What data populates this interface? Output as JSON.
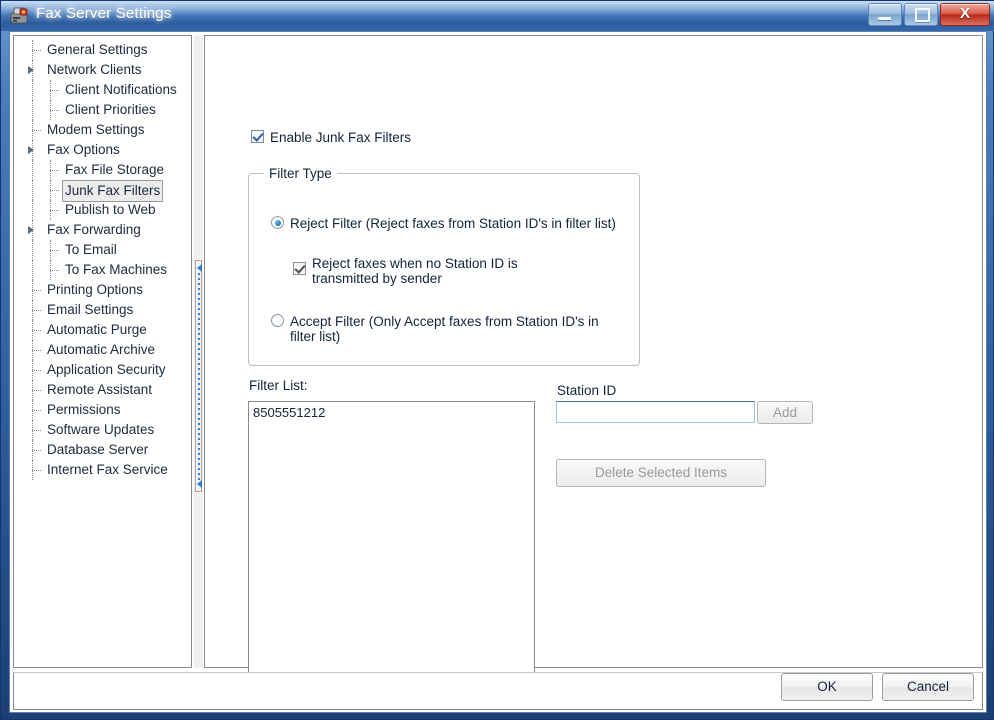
{
  "window": {
    "title": "Fax Server Settings",
    "icon": "fax-machine-icon",
    "controls": {
      "minimize": "Minimize",
      "maximize": "Maximize",
      "close": "Close",
      "close_glyph": "X"
    }
  },
  "sidebar": {
    "items": [
      {
        "label": "General Settings",
        "level": 1,
        "expandable": false,
        "selected": false
      },
      {
        "label": "Network Clients",
        "level": 1,
        "expandable": true,
        "selected": false
      },
      {
        "label": "Client Notifications",
        "level": 2,
        "expandable": false,
        "selected": false
      },
      {
        "label": "Client Priorities",
        "level": 2,
        "expandable": false,
        "selected": false
      },
      {
        "label": "Modem Settings",
        "level": 1,
        "expandable": false,
        "selected": false
      },
      {
        "label": "Fax Options",
        "level": 1,
        "expandable": true,
        "selected": false
      },
      {
        "label": "Fax File Storage",
        "level": 2,
        "expandable": false,
        "selected": false
      },
      {
        "label": "Junk Fax Filters",
        "level": 2,
        "expandable": false,
        "selected": true
      },
      {
        "label": "Publish to Web",
        "level": 2,
        "expandable": false,
        "selected": false
      },
      {
        "label": "Fax Forwarding",
        "level": 1,
        "expandable": true,
        "selected": false
      },
      {
        "label": "To Email",
        "level": 2,
        "expandable": false,
        "selected": false
      },
      {
        "label": "To Fax Machines",
        "level": 2,
        "expandable": false,
        "selected": false
      },
      {
        "label": "Printing Options",
        "level": 1,
        "expandable": false,
        "selected": false
      },
      {
        "label": "Email Settings",
        "level": 1,
        "expandable": false,
        "selected": false
      },
      {
        "label": "Automatic Purge",
        "level": 1,
        "expandable": false,
        "selected": false
      },
      {
        "label": "Automatic Archive",
        "level": 1,
        "expandable": false,
        "selected": false
      },
      {
        "label": "Application Security",
        "level": 1,
        "expandable": false,
        "selected": false
      },
      {
        "label": "Remote Assistant",
        "level": 1,
        "expandable": false,
        "selected": false
      },
      {
        "label": "Permissions",
        "level": 1,
        "expandable": false,
        "selected": false
      },
      {
        "label": "Software Updates",
        "level": 1,
        "expandable": false,
        "selected": false
      },
      {
        "label": "Database Server",
        "level": 1,
        "expandable": false,
        "selected": false
      },
      {
        "label": "Internet Fax Service",
        "level": 1,
        "expandable": false,
        "selected": false
      }
    ]
  },
  "main": {
    "enable_checkbox": {
      "label": "Enable Junk Fax Filters",
      "checked": true
    },
    "filter_type": {
      "legend": "Filter Type",
      "reject_option": {
        "label": "Reject Filter (Reject faxes from Station ID's in filter list)",
        "selected": true
      },
      "no_station_id_checkbox": {
        "label": "Reject faxes when no Station ID is transmitted by sender",
        "checked": true
      },
      "accept_option": {
        "label": "Accept Filter (Only Accept faxes from Station ID's in filter list)",
        "selected": false
      }
    },
    "filter_list": {
      "label": "Filter List:",
      "items": [
        "8505551212"
      ]
    },
    "station_id": {
      "label": "Station ID",
      "value": "",
      "placeholder": ""
    },
    "add_button": {
      "label": "Add",
      "enabled": false
    },
    "delete_button": {
      "label": "Delete Selected Items",
      "enabled": false
    }
  },
  "footer": {
    "ok_label": "OK",
    "cancel_label": "Cancel"
  },
  "colors": {
    "titlebar_blue": "#3f72b4",
    "accent_blue": "#2b5fa8",
    "close_red": "#b8291a",
    "selection_gray": "#ececec",
    "splitter_dot_blue": "#2f7fd4"
  }
}
